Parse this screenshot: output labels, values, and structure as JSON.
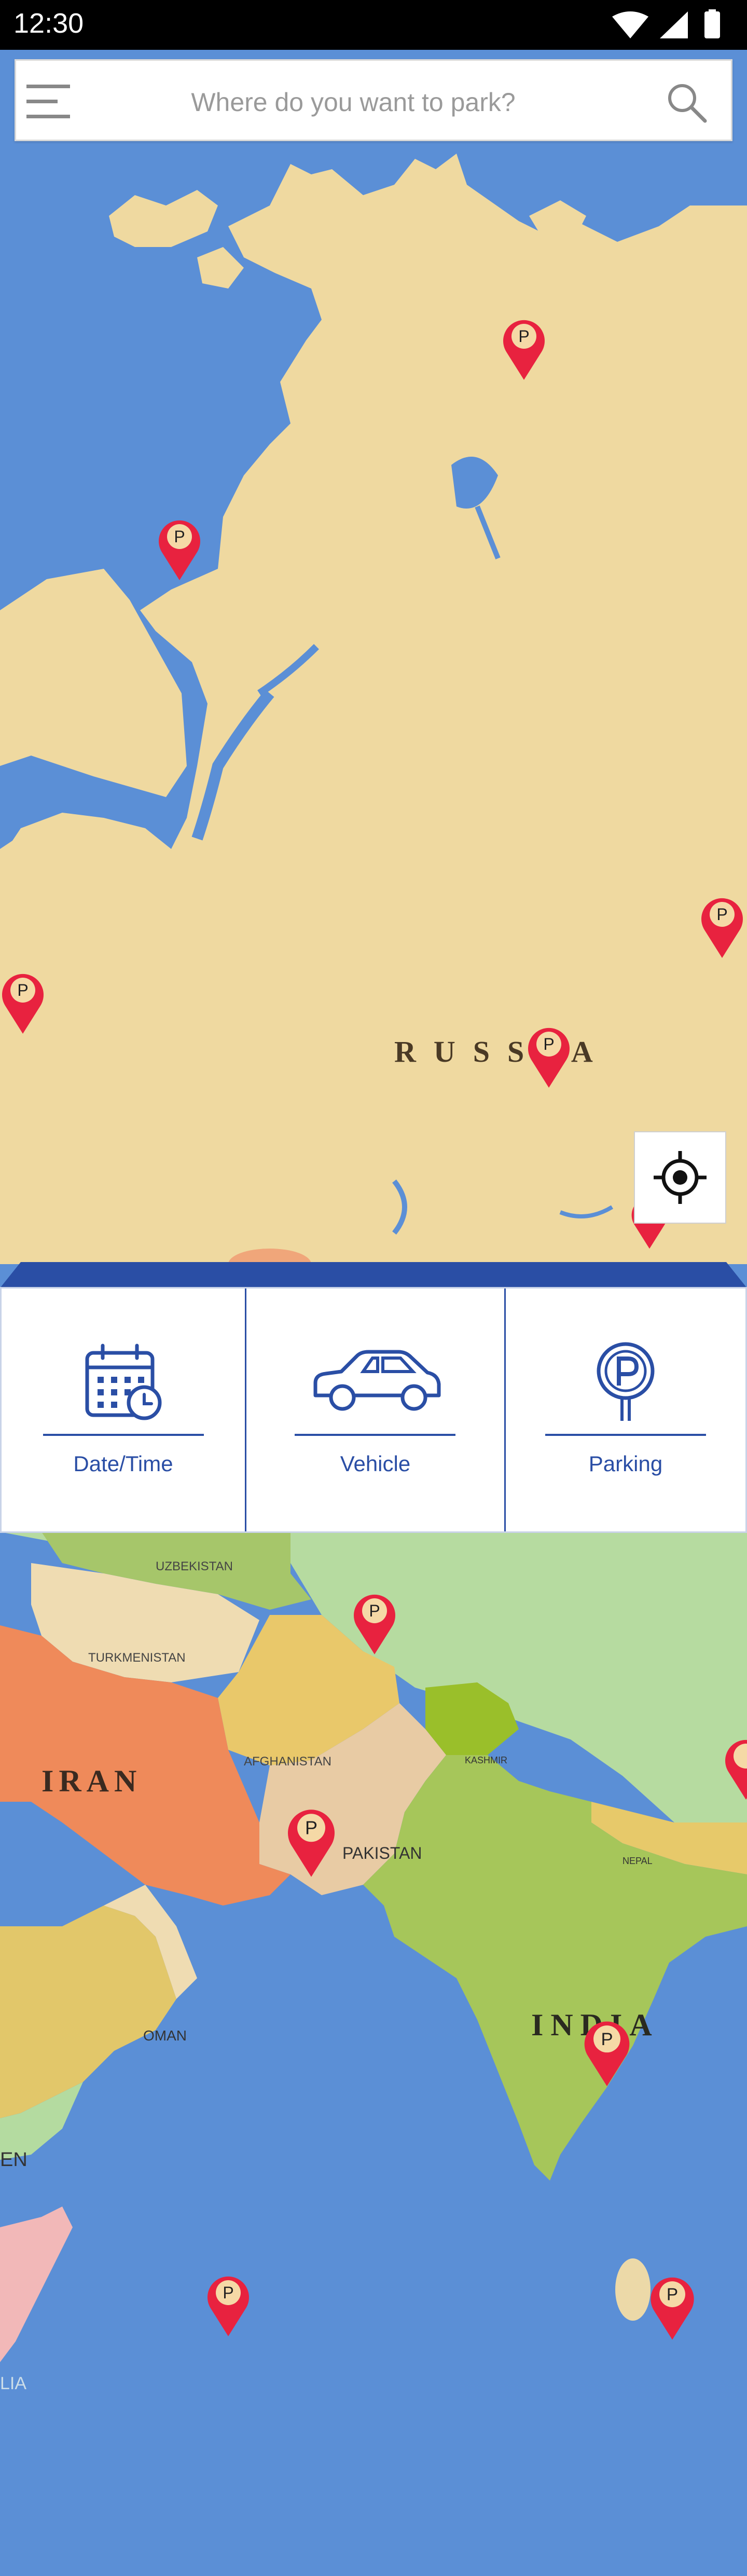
{
  "status_bar": {
    "time": "12:30"
  },
  "search": {
    "placeholder": "Where do you want to park?"
  },
  "map": {
    "labels": {
      "russia": "RUSSIA",
      "uzbekistan": "UZBEKISTAN",
      "turkmenistan": "TURKMENISTAN",
      "iran": "IRAN",
      "afghanistan": "AFGHANISTAN",
      "kashmir": "KASHMIR",
      "pakistan": "PAKISTAN",
      "nepal": "NEPAL",
      "oman": "OMAN",
      "india": "INDIA",
      "yemen": "EN",
      "somalia": "LIA"
    },
    "pin_label": "P"
  },
  "panel": {
    "tiles": [
      {
        "label": "Date/Time",
        "icon": "calendar-clock-icon"
      },
      {
        "label": "Vehicle",
        "icon": "car-icon"
      },
      {
        "label": "Parking",
        "icon": "parking-sign-icon"
      }
    ]
  },
  "colors": {
    "sea": "#5b8fd6",
    "land": "#efd9a0",
    "pin": "#e8223f",
    "accent": "#2a4ea5"
  }
}
